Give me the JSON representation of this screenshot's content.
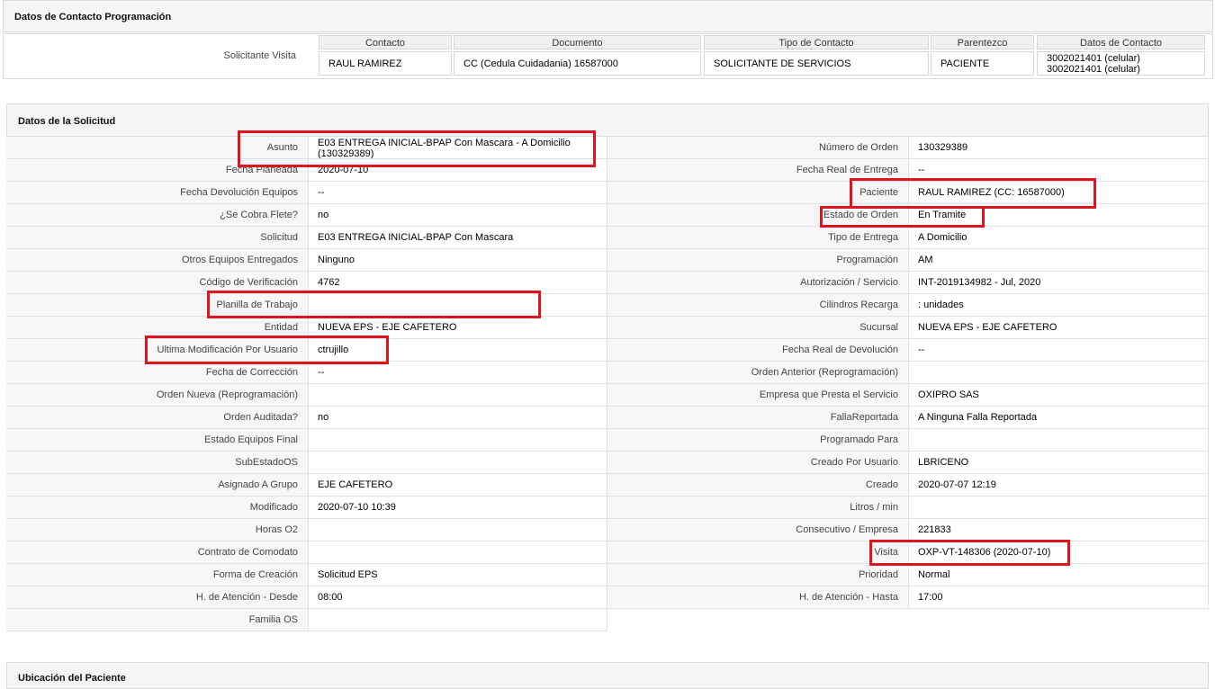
{
  "contact_section": {
    "title": "Datos de Contacto Programación",
    "row_label": "Solicitante Visita",
    "headers": [
      "Contacto",
      "Documento",
      "Tipo de Contacto",
      "Parentezco",
      "Datos de Contacto"
    ],
    "row": {
      "contacto": "RAUL RAMIREZ",
      "documento": "CC (Cedula Cuidadania) 16587000",
      "tipo": "SOLICITANTE DE SERVICIOS",
      "parentezco": "PACIENTE",
      "datos_1": "3002021401 (celular)",
      "datos_2": "3002021401 (celular)"
    }
  },
  "request_section": {
    "title": "Datos de la Solicitud",
    "left": [
      {
        "label": "Asunto",
        "value": "E03 ENTREGA INICIAL-BPAP Con Mascara - A Domicilio (130329389)"
      },
      {
        "label": "Fecha Planeada",
        "value": "2020-07-10"
      },
      {
        "label": "Fecha Devolución Equipos",
        "value": "--"
      },
      {
        "label": "¿Se Cobra Flete?",
        "value": "no"
      },
      {
        "label": "Solicitud",
        "value": "E03 ENTREGA INICIAL-BPAP Con Mascara"
      },
      {
        "label": "Otros Equipos Entregados",
        "value": "Ninguno"
      },
      {
        "label": "Código de Verificación",
        "value": "4762"
      },
      {
        "label": "Planilla de Trabajo",
        "value": ""
      },
      {
        "label": "Entidad",
        "value": "NUEVA EPS - EJE CAFETERO"
      },
      {
        "label": "Ultima Modificación Por Usuario",
        "value": "ctrujillo"
      },
      {
        "label": "Fecha de Corrección",
        "value": "--"
      },
      {
        "label": "Orden Nueva (Reprogramación)",
        "value": ""
      },
      {
        "label": "Orden Auditada?",
        "value": "no"
      },
      {
        "label": "Estado Equipos Final",
        "value": ""
      },
      {
        "label": "SubEstadoOS",
        "value": ""
      },
      {
        "label": "Asignado A Grupo",
        "value": "EJE CAFETERO"
      },
      {
        "label": "Modificado",
        "value": "2020-07-10 10:39"
      },
      {
        "label": "Horas O2",
        "value": ""
      },
      {
        "label": "Contrato de Comodato",
        "value": ""
      },
      {
        "label": "Forma de Creación",
        "value": "Solicitud EPS"
      },
      {
        "label": "H. de Atención - Desde",
        "value": "08:00"
      },
      {
        "label": "Familia OS",
        "value": ""
      }
    ],
    "right": [
      {
        "label": "Número de Orden",
        "value": "130329389"
      },
      {
        "label": "Fecha Real de Entrega",
        "value": "--"
      },
      {
        "label": "Paciente",
        "value": "RAUL RAMIREZ (CC: 16587000)"
      },
      {
        "label": "Estado de Orden",
        "value": "En Tramite"
      },
      {
        "label": "Tipo de Entrega",
        "value": "A Domicilio"
      },
      {
        "label": "Programación",
        "value": "AM"
      },
      {
        "label": "Autorización / Servicio",
        "value": "INT-2019134982 - Jul, 2020"
      },
      {
        "label": "Cilindros Recarga",
        "value": ": unidades"
      },
      {
        "label": "Sucursal",
        "value": "NUEVA EPS - EJE CAFETERO"
      },
      {
        "label": "Fecha Real de Devolución",
        "value": "--"
      },
      {
        "label": "Orden Anterior (Reprogramación)",
        "value": ""
      },
      {
        "label": "Empresa que Presta el Servicio",
        "value": "OXIPRO SAS"
      },
      {
        "label": "FallaReportada",
        "value": "A Ninguna Falla Reportada"
      },
      {
        "label": "Programado Para",
        "value": ""
      },
      {
        "label": "Creado Por Usuario",
        "value": "LBRICENO"
      },
      {
        "label": "Creado",
        "value": "2020-07-07 12:19"
      },
      {
        "label": "Litros / min",
        "value": ""
      },
      {
        "label": "Consecutivo / Empresa",
        "value": "221833"
      },
      {
        "label": "Visita",
        "value": "OXP-VT-148306 (2020-07-10)"
      },
      {
        "label": "Prioridad",
        "value": "Normal"
      },
      {
        "label": "H. de Atención - Hasta",
        "value": "17:00"
      }
    ]
  },
  "location_section": {
    "title": "Ubicación del Paciente"
  },
  "colors": {
    "highlight": "#e0141e",
    "header_bg": "#f5f5f5",
    "label_bg": "#f7f7f7",
    "border": "#dcdcdc"
  }
}
